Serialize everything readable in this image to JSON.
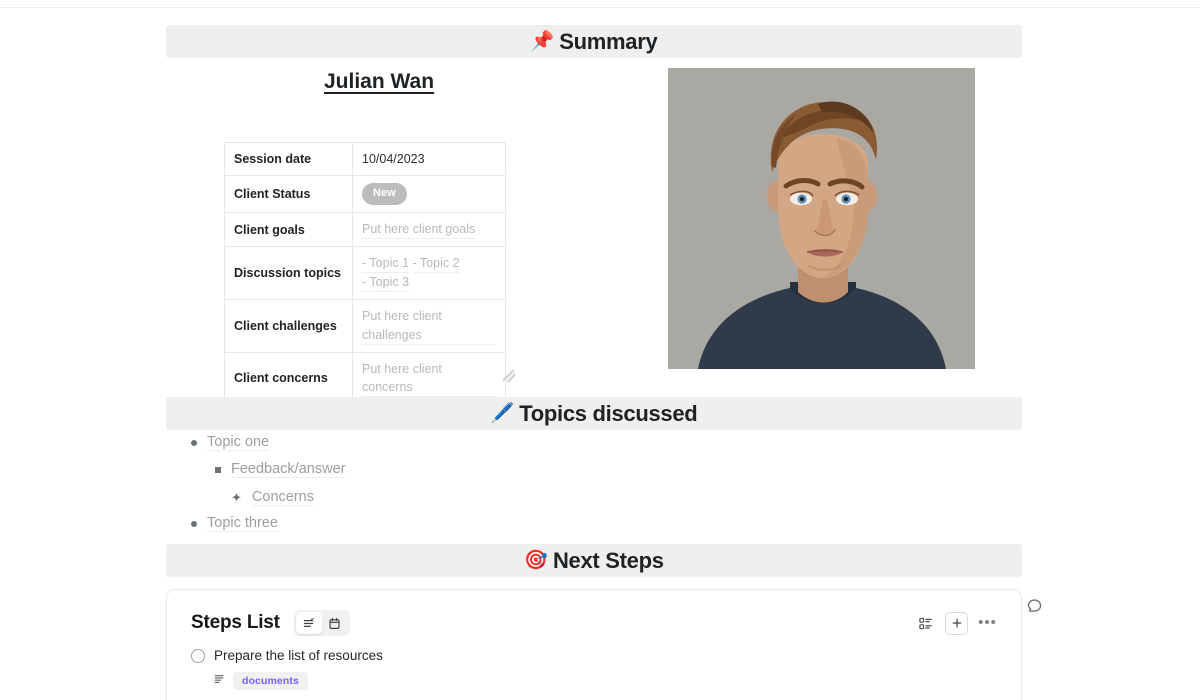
{
  "sections": {
    "summary": {
      "emoji": "📌",
      "title": "Summary",
      "emoji_name": "pushpin-emoji"
    },
    "topics": {
      "emoji": "🖊️",
      "title": "Topics discussed",
      "emoji_name": "pen-emoji"
    },
    "next": {
      "emoji": "🎯",
      "title": "Next Steps",
      "emoji_name": "dart-emoji"
    }
  },
  "client": {
    "name": "Julian Wan",
    "photo_alt": "portrait-photo"
  },
  "table": {
    "rows": [
      {
        "key": "Session date",
        "value": "10/04/2023",
        "type": "text"
      },
      {
        "key": "Client Status",
        "value": "New",
        "type": "badge"
      },
      {
        "key": "Client goals",
        "value": "Put here client goals",
        "type": "placeholder"
      },
      {
        "key": "Discussion topics",
        "value": "- Topic 1\n- Topic 2\n- Topic 3",
        "type": "placeholder-multi",
        "lines": [
          "- Topic 1",
          "- Topic 2",
          "- Topic 3"
        ]
      },
      {
        "key": "Client challenges",
        "value": "Put here client challenges",
        "type": "placeholder"
      },
      {
        "key": "Client concerns",
        "value": "Put here client concerns",
        "type": "placeholder"
      }
    ]
  },
  "topics_list": [
    {
      "label": "Topic one",
      "level": 1,
      "marker": "disc"
    },
    {
      "label": "Feedback/answer",
      "level": 2,
      "marker": "square"
    },
    {
      "label": "Concerns",
      "level": 3,
      "marker": "star"
    },
    {
      "label": "Topic three",
      "level": 1,
      "marker": "disc"
    }
  ],
  "steps_card": {
    "title": "Steps List",
    "view_tabs": [
      {
        "icon": "list-view-icon",
        "active": true
      },
      {
        "icon": "calendar-view-icon",
        "active": false
      }
    ],
    "actions": [
      {
        "icon": "grid-view-icon",
        "label": ""
      },
      {
        "icon": "add-icon",
        "label": "+"
      },
      {
        "icon": "more-options-icon",
        "label": "•••"
      }
    ],
    "items": [
      {
        "label": "Prepare the list of resources",
        "checked": false,
        "tag": "documents",
        "meta_icon": "description-icon"
      }
    ]
  },
  "colors": {
    "section_bar_bg": "#efefef",
    "badge_bg": "#bcbcbc",
    "tag_text": "#7b5cf0",
    "placeholder": "#b6b9bd"
  }
}
